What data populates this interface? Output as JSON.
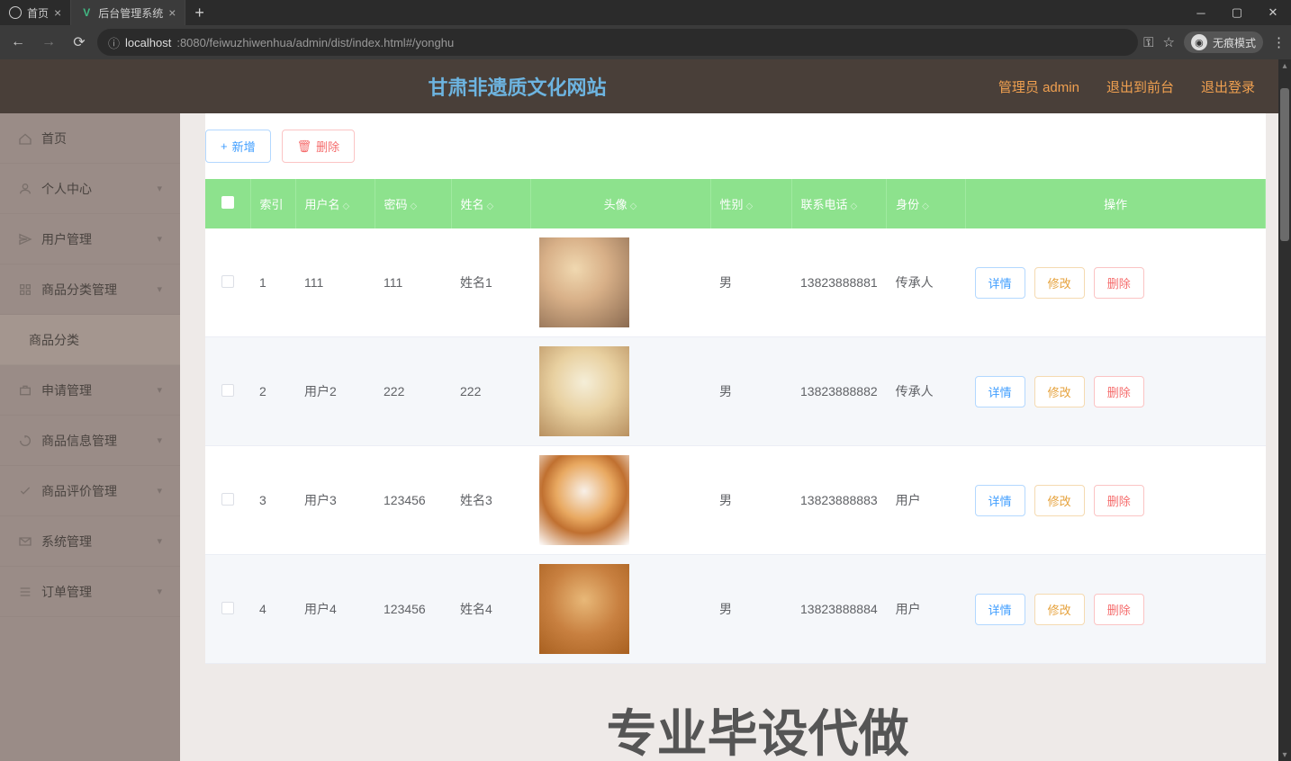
{
  "browser": {
    "tabs": [
      {
        "title": "首页",
        "active": false
      },
      {
        "title": "后台管理系统",
        "active": true
      }
    ],
    "url_host": "localhost",
    "url_port_path": ":8080/feiwuzhiwenhua/admin/dist/index.html#/yonghu",
    "incognito_label": "无痕模式"
  },
  "header": {
    "site_title": "甘肃非遗质文化网站",
    "admin_label": "管理员 admin",
    "back_front_label": "退出到前台",
    "logout_label": "退出登录"
  },
  "sidebar": {
    "items": [
      {
        "label": "首页",
        "icon": "home-icon",
        "expandable": false
      },
      {
        "label": "个人中心",
        "icon": "user-icon",
        "expandable": true
      },
      {
        "label": "用户管理",
        "icon": "send-icon",
        "expandable": true
      },
      {
        "label": "商品分类管理",
        "icon": "grid-icon",
        "expandable": true
      },
      {
        "label": "商品分类",
        "icon": "",
        "expandable": false,
        "sub": true
      },
      {
        "label": "申请管理",
        "icon": "briefcase-icon",
        "expandable": true
      },
      {
        "label": "商品信息管理",
        "icon": "refresh-icon",
        "expandable": true
      },
      {
        "label": "商品评价管理",
        "icon": "check-icon",
        "expandable": true
      },
      {
        "label": "系统管理",
        "icon": "mail-icon",
        "expandable": true
      },
      {
        "label": "订单管理",
        "icon": "list-icon",
        "expandable": true
      }
    ]
  },
  "toolbar": {
    "add_label": "新增",
    "delete_label": "删除"
  },
  "table": {
    "headers": {
      "index": "索引",
      "username": "用户名",
      "password": "密码",
      "name": "姓名",
      "avatar": "头像",
      "gender": "性别",
      "phone": "联系电话",
      "identity": "身份",
      "ops": "操作"
    },
    "ops_labels": {
      "detail": "详情",
      "edit": "修改",
      "delete": "删除"
    },
    "rows": [
      {
        "index": "1",
        "username": "111",
        "password": "111",
        "name": "姓名1",
        "avatar_class": "av1",
        "gender": "男",
        "phone": "13823888881",
        "identity": "传承人"
      },
      {
        "index": "2",
        "username": "用户2",
        "password": "222",
        "name": "222",
        "avatar_class": "av2",
        "gender": "男",
        "phone": "13823888882",
        "identity": "传承人"
      },
      {
        "index": "3",
        "username": "用户3",
        "password": "123456",
        "name": "姓名3",
        "avatar_class": "av3",
        "gender": "男",
        "phone": "13823888883",
        "identity": "用户"
      },
      {
        "index": "4",
        "username": "用户4",
        "password": "123456",
        "name": "姓名4",
        "avatar_class": "av4",
        "gender": "男",
        "phone": "13823888884",
        "identity": "用户"
      }
    ]
  },
  "watermark": "专业毕设代做"
}
